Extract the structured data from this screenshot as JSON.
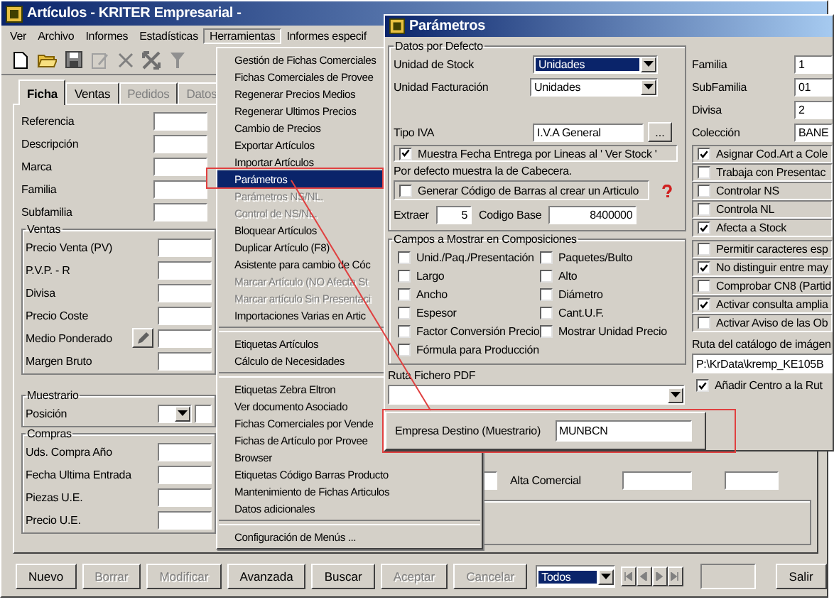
{
  "window": {
    "title": "Artículos - KRITER Empresarial -"
  },
  "menu_bar": [
    {
      "label": "Ver",
      "selected": false
    },
    {
      "label": "Archivo",
      "selected": false
    },
    {
      "label": "Informes",
      "selected": false
    },
    {
      "label": "Estadísticas",
      "selected": false
    },
    {
      "label": "Herramientas",
      "selected": true
    },
    {
      "label": "Informes especif",
      "selected": false
    }
  ],
  "tabs": [
    {
      "label": "Ficha",
      "selected": true,
      "disabled": false
    },
    {
      "label": "Ventas",
      "selected": false,
      "disabled": false
    },
    {
      "label": "Pedidos",
      "selected": false,
      "disabled": true
    },
    {
      "label": "Datos",
      "selected": false,
      "disabled": true
    }
  ],
  "form": {
    "fields": [
      {
        "kind": "text",
        "label": "Referencia"
      },
      {
        "kind": "text",
        "label": "Descripción"
      },
      {
        "kind": "text",
        "label": "Marca"
      },
      {
        "kind": "text",
        "label": "Familia"
      },
      {
        "kind": "text",
        "label": "Subfamilia"
      }
    ],
    "groups": [
      {
        "title": "Ventas",
        "fields": [
          {
            "kind": "text",
            "label": "Precio Venta (PV)"
          },
          {
            "kind": "text",
            "label": "P.V.P. - R"
          },
          {
            "kind": "text",
            "label": "Divisa"
          },
          {
            "kind": "text",
            "label": "Precio Coste"
          },
          {
            "kind": "pencil",
            "label": "Medio Ponderado"
          },
          {
            "kind": "text",
            "label": "Margen Bruto"
          }
        ]
      },
      {
        "title": "Muestrario",
        "fields": [
          {
            "kind": "combo",
            "label": "Posición"
          }
        ]
      },
      {
        "title": "Compras",
        "fields": [
          {
            "kind": "text",
            "label": "Uds. Compra Año"
          },
          {
            "kind": "text",
            "label": "Fecha Ultima Entrada"
          },
          {
            "kind": "text",
            "label": "Piezas U.E."
          },
          {
            "kind": "text",
            "label": "Precio U.E."
          }
        ]
      }
    ]
  },
  "sales_panel": {
    "label": "Alta Comercial"
  },
  "bottom_bar": {
    "buttons": [
      {
        "label": "Nuevo",
        "disabled": false
      },
      {
        "label": "Borrar",
        "disabled": true
      },
      {
        "label": "Modificar",
        "disabled": true
      },
      {
        "label": "Avanzada",
        "disabled": false
      },
      {
        "label": "Buscar",
        "disabled": false
      },
      {
        "label": "Aceptar",
        "disabled": true
      },
      {
        "label": "Cancelar",
        "disabled": true
      }
    ],
    "filter": {
      "value": "Todos",
      "highlighted": true
    },
    "exit": "Salir"
  },
  "menu": {
    "items": [
      {
        "kind": "item",
        "label": "Gestión de Fichas Comerciales",
        "selected": false,
        "disabled": false
      },
      {
        "kind": "item",
        "label": "Fichas Comerciales de Provee",
        "selected": false,
        "disabled": false
      },
      {
        "kind": "item",
        "label": "Regenerar Precios Medios",
        "selected": false,
        "disabled": false
      },
      {
        "kind": "item",
        "label": "Regenerar Ultimos Precios",
        "selected": false,
        "disabled": false
      },
      {
        "kind": "item",
        "label": "Cambio de Precios",
        "selected": false,
        "disabled": false
      },
      {
        "kind": "item",
        "label": "Exportar Artículos",
        "selected": false,
        "disabled": false
      },
      {
        "kind": "item",
        "label": "Importar Artículos",
        "selected": false,
        "disabled": false
      },
      {
        "kind": "item",
        "label": "Parámetros",
        "selected": true,
        "disabled": false
      },
      {
        "kind": "item",
        "label": "Parámetros NS/NL.",
        "selected": false,
        "disabled": true
      },
      {
        "kind": "item",
        "label": "Control de NS/NL.",
        "selected": false,
        "disabled": true
      },
      {
        "kind": "item",
        "label": "Bloquear Artículos",
        "selected": false,
        "disabled": false
      },
      {
        "kind": "item",
        "label": "Duplicar Artículo (F8)",
        "selected": false,
        "disabled": false
      },
      {
        "kind": "item",
        "label": "Asistente para cambio de Cóc",
        "selected": false,
        "disabled": false
      },
      {
        "kind": "item",
        "label": "Marcar Artículo (NO Afecta St",
        "selected": false,
        "disabled": true
      },
      {
        "kind": "item",
        "label": "Marcar artículo Sin Presentaci",
        "selected": false,
        "disabled": true
      },
      {
        "kind": "item",
        "label": "Importaciones Varias en Artic",
        "selected": false,
        "disabled": false
      },
      {
        "kind": "separator"
      },
      {
        "kind": "item",
        "label": "Etiquetas Artículos",
        "selected": false,
        "disabled": false
      },
      {
        "kind": "item",
        "label": "Cálculo de Necesidades",
        "selected": false,
        "disabled": false
      },
      {
        "kind": "separator"
      },
      {
        "kind": "item",
        "label": "Etiquetas Zebra Eltron",
        "selected": false,
        "disabled": false
      },
      {
        "kind": "item",
        "label": "Ver documento Asociado",
        "selected": false,
        "disabled": false
      },
      {
        "kind": "item",
        "label": "Fichas Comerciales por Vende",
        "selected": false,
        "disabled": false
      },
      {
        "kind": "item",
        "label": "Fichas de Artículo por Provee",
        "selected": false,
        "disabled": false
      },
      {
        "kind": "item",
        "label": "Browser",
        "selected": false,
        "disabled": false
      },
      {
        "kind": "item",
        "label": "Etiquetas Código Barras Producto",
        "selected": false,
        "disabled": false
      },
      {
        "kind": "item",
        "label": "Mantenimiento de Fichas Articulos",
        "selected": false,
        "disabled": false
      },
      {
        "kind": "item",
        "label": "Datos adicionales",
        "selected": false,
        "disabled": false
      },
      {
        "kind": "separator"
      },
      {
        "kind": "item",
        "label": "Configuración de Menús ...",
        "selected": false,
        "disabled": false
      }
    ]
  },
  "dialog": {
    "title": "Parámetros",
    "defaults": {
      "title": "Datos por Defecto",
      "stock_unit": {
        "label": "Unidad de Stock",
        "value": "Unidades",
        "highlighted": true
      },
      "billing_unit": {
        "label": "Unidad Facturación",
        "value": "Unidades",
        "highlighted": false
      },
      "vat_type": {
        "label": "Tipo IVA",
        "value": "I.V.A General",
        "button": "..."
      },
      "delivery_date": {
        "label": "Muestra Fecha Entrega por Lineas al  ' Ver Stock '",
        "checked": true
      },
      "note": "Por defecto muestra la de Cabecera.",
      "barcode": {
        "label": "Generar Código de Barras al crear un Articulo",
        "checked": false
      },
      "extract": {
        "label": "Extraer",
        "value": "5"
      },
      "base_code": {
        "label": "Codigo Base",
        "value": "8400000"
      }
    },
    "composition": {
      "title": "Campos a Mostrar en Composiciones",
      "options": [
        {
          "label": "Unid./Paq./Presentación",
          "checked": false
        },
        {
          "label": "Paquetes/Bulto",
          "checked": false
        },
        {
          "label": "Largo",
          "checked": false
        },
        {
          "label": "Alto",
          "checked": false
        },
        {
          "label": "Ancho",
          "checked": false
        },
        {
          "label": "Diámetro",
          "checked": false
        },
        {
          "label": "Espesor",
          "checked": false
        },
        {
          "label": "Cant.U.F.",
          "checked": false
        },
        {
          "label": "Factor Conversión Precio",
          "checked": false
        },
        {
          "label": "Mostrar Unidad Precio",
          "checked": false
        },
        {
          "label": "Fórmula para Producción",
          "checked": false
        }
      ]
    },
    "pdf_path": {
      "label": "Ruta Fichero PDF"
    },
    "right_fields": [
      {
        "label": "Familia",
        "value": "1"
      },
      {
        "label": "SubFamilia",
        "value": "01"
      },
      {
        "label": "Divisa",
        "value": "2"
      },
      {
        "label": "Colección",
        "value": "BANE"
      }
    ],
    "options_a": [
      {
        "label": "Asignar Cod.Art a Cole",
        "checked": true
      },
      {
        "label": "Trabaja con Presentac",
        "checked": false
      },
      {
        "label": "Controlar NS",
        "checked": false
      },
      {
        "label": "Controla NL",
        "checked": false
      },
      {
        "label": "Afecta a Stock",
        "checked": true
      }
    ],
    "options_b": [
      {
        "label": "Permitir caracteres esp",
        "checked": false
      },
      {
        "label": "No distinguir entre may",
        "checked": true
      },
      {
        "label": "Comprobar CN8 (Partid",
        "checked": false
      },
      {
        "label": "Activar consulta amplia",
        "checked": true
      },
      {
        "label": "Activar Aviso de las Ob",
        "checked": false
      }
    ],
    "image_path": {
      "label": "Ruta del catálogo de imágen",
      "value": "P:\\KrData\\kremp_KE105B"
    },
    "add_center": {
      "label": "Añadir Centro a la Rut",
      "checked": true
    },
    "sample_company": {
      "label": "Empresa Destino (Muestrario)",
      "value": "MUNBCN"
    }
  }
}
